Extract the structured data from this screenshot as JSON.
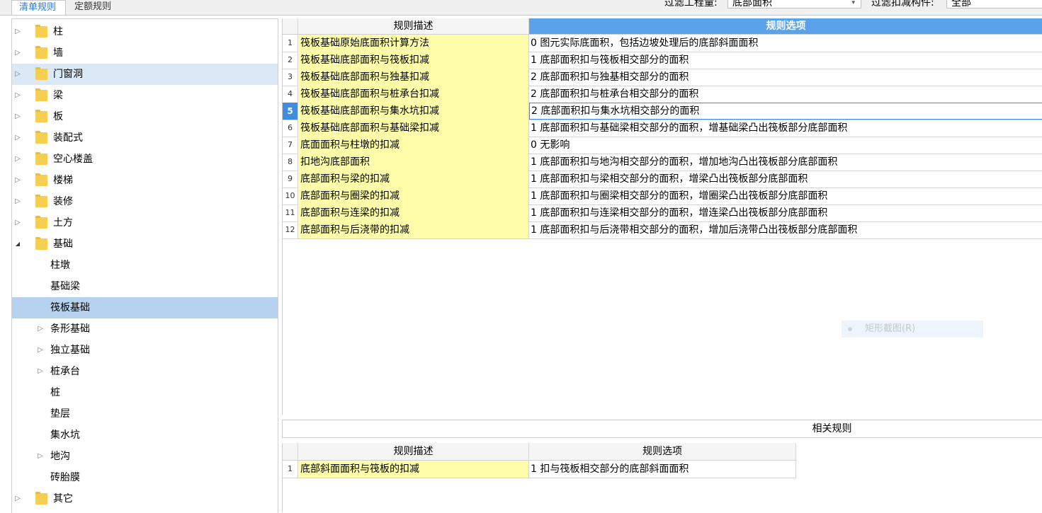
{
  "tabs": [
    {
      "label": "清单规则",
      "active": true
    },
    {
      "label": "定额规则",
      "active": false
    }
  ],
  "filters": {
    "quantity_label": "过滤工程量:",
    "quantity_value": "底部面积",
    "component_label": "过滤扣减构件:",
    "component_value": "全部"
  },
  "tree": [
    {
      "label": "柱",
      "level": 0,
      "folder": true,
      "expand": "collapsed"
    },
    {
      "label": "墙",
      "level": 0,
      "folder": true,
      "expand": "collapsed"
    },
    {
      "label": "门窗洞",
      "level": 0,
      "folder": true,
      "expand": "collapsed",
      "state": "hover"
    },
    {
      "label": "梁",
      "level": 0,
      "folder": true,
      "expand": "collapsed"
    },
    {
      "label": "板",
      "level": 0,
      "folder": true,
      "expand": "collapsed"
    },
    {
      "label": "装配式",
      "level": 0,
      "folder": true,
      "expand": "collapsed"
    },
    {
      "label": "空心楼盖",
      "level": 0,
      "folder": true,
      "expand": "collapsed"
    },
    {
      "label": "楼梯",
      "level": 0,
      "folder": true,
      "expand": "collapsed"
    },
    {
      "label": "装修",
      "level": 0,
      "folder": true,
      "expand": "collapsed"
    },
    {
      "label": "土方",
      "level": 0,
      "folder": true,
      "expand": "collapsed"
    },
    {
      "label": "基础",
      "level": 0,
      "folder": true,
      "expand": "expanded"
    },
    {
      "label": "柱墩",
      "level": 1,
      "folder": false,
      "expand": "none"
    },
    {
      "label": "基础梁",
      "level": 1,
      "folder": false,
      "expand": "none"
    },
    {
      "label": "筏板基础",
      "level": 1,
      "folder": false,
      "expand": "none",
      "state": "selected"
    },
    {
      "label": "条形基础",
      "level": 1,
      "folder": false,
      "expand": "collapsed"
    },
    {
      "label": "独立基础",
      "level": 1,
      "folder": false,
      "expand": "collapsed"
    },
    {
      "label": "桩承台",
      "level": 1,
      "folder": false,
      "expand": "collapsed"
    },
    {
      "label": "桩",
      "level": 1,
      "folder": false,
      "expand": "none"
    },
    {
      "label": "垫层",
      "level": 1,
      "folder": false,
      "expand": "none"
    },
    {
      "label": "集水坑",
      "level": 1,
      "folder": false,
      "expand": "none"
    },
    {
      "label": "地沟",
      "level": 1,
      "folder": false,
      "expand": "collapsed"
    },
    {
      "label": "砖胎膜",
      "level": 1,
      "folder": false,
      "expand": "none"
    },
    {
      "label": "其它",
      "level": 0,
      "folder": true,
      "expand": "collapsed"
    }
  ],
  "grid": {
    "col_desc": "规则描述",
    "col_option": "规则选项",
    "selected_row": 5,
    "rows": [
      {
        "num": "1",
        "desc": "筏板基础原始底面积计算方法",
        "option": "0 图元实际底面积，包括边坡处理后的底部斜面面积"
      },
      {
        "num": "2",
        "desc": "筏板基础底部面积与筏板扣减",
        "option": "1 底部面积扣与筏板相交部分的面积"
      },
      {
        "num": "3",
        "desc": "筏板基础底部面积与独基扣减",
        "option": "2 底部面积扣与独基相交部分的面积"
      },
      {
        "num": "4",
        "desc": "筏板基础底部面积与桩承台扣减",
        "option": "2 底部面积扣与桩承台相交部分的面积"
      },
      {
        "num": "5",
        "desc": "筏板基础底部面积与集水坑扣减",
        "option": "2 底部面积扣与集水坑相交部分的面积"
      },
      {
        "num": "6",
        "desc": "筏板基础底部面积与基础梁扣减",
        "option": "1 底部面积扣与基础梁相交部分的面积，增基础梁凸出筏板部分底部面积"
      },
      {
        "num": "7",
        "desc": "底面面积与柱墩的扣减",
        "option": "0  无影响"
      },
      {
        "num": "8",
        "desc": "扣地沟底部面积",
        "option": "1 底部面积扣与地沟相交部分的面积，增加地沟凸出筏板部分底部面积"
      },
      {
        "num": "9",
        "desc": "底部面积与梁的扣减",
        "option": "1 底部面积扣与梁相交部分的面积，增梁凸出筏板部分底部面积"
      },
      {
        "num": "10",
        "desc": "底部面积与圈梁的扣减",
        "option": "1 底部面积扣与圈梁相交部分的面积，增圈梁凸出筏板部分底部面积"
      },
      {
        "num": "11",
        "desc": "底部面积与连梁的扣减",
        "option": "1 底部面积扣与连梁相交部分的面积，增连梁凸出筏板部分底部面积"
      },
      {
        "num": "12",
        "desc": "底部面积与后浇带的扣减",
        "option": "1 底部面积扣与后浇带相交部分的面积，增加后浇带凸出筏板部分底部面积"
      }
    ]
  },
  "hint": "矩形截图(R)",
  "related": {
    "title": "相关规则",
    "col_desc": "规则描述",
    "col_option": "规则选项",
    "rows": [
      {
        "num": "1",
        "desc": "底部斜面面积与筏板的扣减",
        "option": "1 扣与筏板相交部分的底部斜面面积"
      }
    ]
  },
  "colors": {
    "accent": "#5aa2ea",
    "selected_row": "#3e8de0",
    "desc_cell": "#fdfdaa",
    "tab_active_text": "#2b78d0",
    "folder": "#f6cf52"
  },
  "icons": {
    "collapsed": "triangle-right-icon",
    "expanded": "triangle-down-icon",
    "folder": "folder-icon",
    "dropdown": "chevron-down-icon"
  }
}
